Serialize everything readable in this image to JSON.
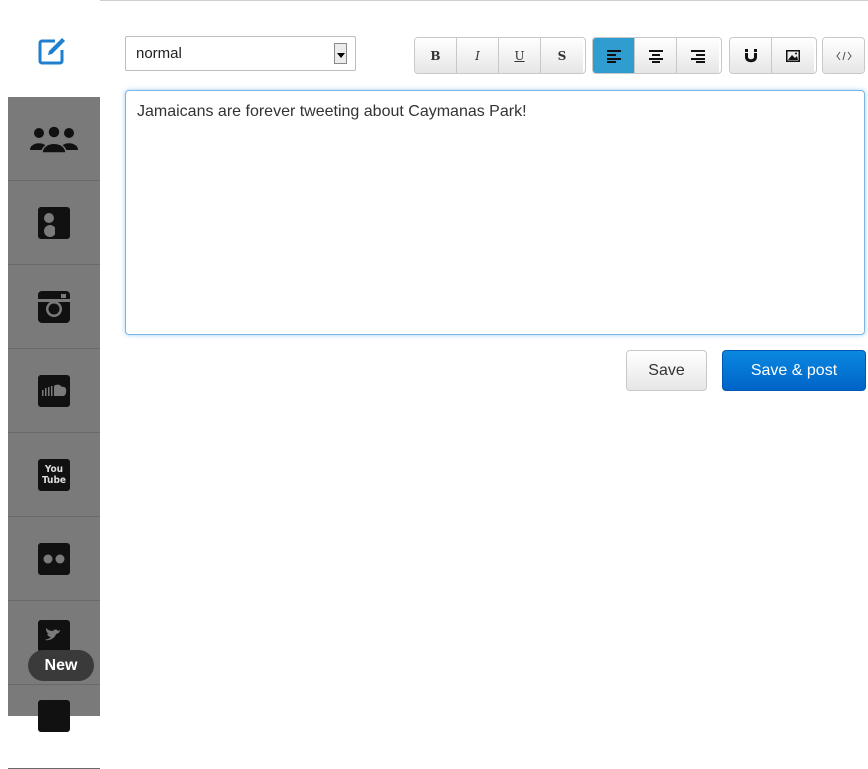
{
  "sidebar": {
    "compose_icon": "edit-icon",
    "items": [
      {
        "icon": "group-icon"
      },
      {
        "icon": "google-plus-icon"
      },
      {
        "icon": "instagram-icon"
      },
      {
        "icon": "soundcloud-icon"
      },
      {
        "icon": "youtube-icon",
        "label_line1": "You",
        "label_line2": "Tube"
      },
      {
        "icon": "flickr-icon"
      },
      {
        "icon": "twitter-icon"
      }
    ],
    "new_badge": "New"
  },
  "toolbar": {
    "style_select": "normal",
    "bold": "B",
    "italic": "I",
    "underline": "U",
    "strike": "S"
  },
  "editor": {
    "text": "Jamaicans are forever tweeting about Caymanas Park!"
  },
  "actions": {
    "save": "Save",
    "save_post": "Save & post"
  },
  "colors": {
    "accent": "#2f9dd0",
    "primary_button": "#0a74d8",
    "sidebar_bg": "#7a7a7a"
  }
}
